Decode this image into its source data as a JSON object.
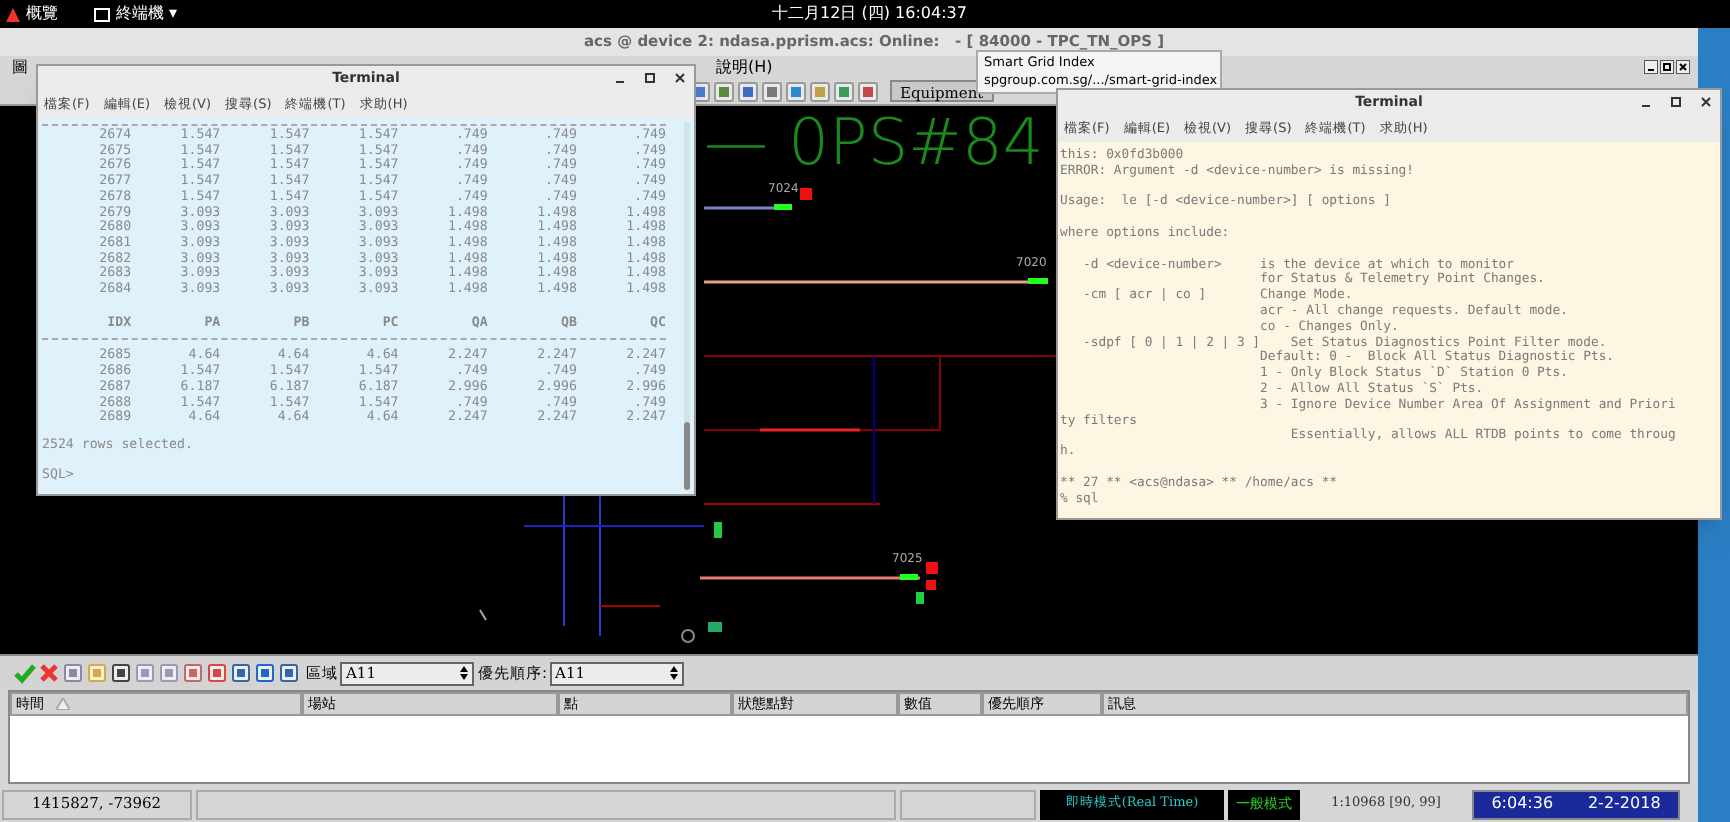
{
  "top_bar": {
    "activities": "概覽",
    "app_menu": "終端機 ▾",
    "clock": "十二月12日 (四) 16:04:37"
  },
  "app_window": {
    "title": "acs @ device 2: ndasa.pprism.acs: Online:   - [ 84000 - TPC_TN_OPS ]",
    "menus": [
      "圖",
      "說明(H)"
    ],
    "toolbar_button": "Equipment"
  },
  "tooltip": {
    "title": "Smart Grid Index",
    "url": "spgroup.com.sg/.../smart-grid-index"
  },
  "diagram": {
    "title": "— 0PS#84",
    "labels": [
      {
        "text": "7024"
      },
      {
        "text": "7020"
      },
      {
        "text": "7025"
      }
    ]
  },
  "terminal_left": {
    "title": "Terminal",
    "menus": [
      "檔案(F)",
      "編輯(E)",
      "檢視(V)",
      "搜尋(S)",
      "終端機(T)",
      "求助(H)"
    ],
    "rows": [
      [
        "2674",
        "1.547",
        "1.547",
        "1.547",
        ".749",
        ".749",
        ".749"
      ],
      [
        "2675",
        "1.547",
        "1.547",
        "1.547",
        ".749",
        ".749",
        ".749"
      ],
      [
        "2676",
        "1.547",
        "1.547",
        "1.547",
        ".749",
        ".749",
        ".749"
      ],
      [
        "2677",
        "1.547",
        "1.547",
        "1.547",
        ".749",
        ".749",
        ".749"
      ],
      [
        "2678",
        "1.547",
        "1.547",
        "1.547",
        ".749",
        ".749",
        ".749"
      ],
      [
        "2679",
        "3.093",
        "3.093",
        "3.093",
        "1.498",
        "1.498",
        "1.498"
      ],
      [
        "2680",
        "3.093",
        "3.093",
        "3.093",
        "1.498",
        "1.498",
        "1.498"
      ],
      [
        "2681",
        "3.093",
        "3.093",
        "3.093",
        "1.498",
        "1.498",
        "1.498"
      ],
      [
        "2682",
        "3.093",
        "3.093",
        "3.093",
        "1.498",
        "1.498",
        "1.498"
      ],
      [
        "2683",
        "3.093",
        "3.093",
        "3.093",
        "1.498",
        "1.498",
        "1.498"
      ],
      [
        "2684",
        "3.093",
        "3.093",
        "3.093",
        "1.498",
        "1.498",
        "1.498"
      ]
    ],
    "header": [
      "IDX",
      "PA",
      "PB",
      "PC",
      "QA",
      "QB",
      "QC"
    ],
    "rows_after": [
      [
        "2685",
        "4.64",
        "4.64",
        "4.64",
        "2.247",
        "2.247",
        "2.247"
      ],
      [
        "2686",
        "1.547",
        "1.547",
        "1.547",
        ".749",
        ".749",
        ".749"
      ],
      [
        "2687",
        "6.187",
        "6.187",
        "6.187",
        "2.996",
        "2.996",
        "2.996"
      ],
      [
        "2688",
        "1.547",
        "1.547",
        "1.547",
        ".749",
        ".749",
        ".749"
      ],
      [
        "2689",
        "4.64",
        "4.64",
        "4.64",
        "2.247",
        "2.247",
        "2.247"
      ]
    ],
    "footer": "2524 rows selected.",
    "prompt": "SQL>"
  },
  "terminal_right": {
    "title": "Terminal",
    "menus": [
      "檔案(F)",
      "編輯(E)",
      "檢視(V)",
      "搜尋(S)",
      "終端機(T)",
      "求助(H)"
    ],
    "lines": [
      {
        "text": "this: 0x0fd3b000",
        "space_before": false
      },
      {
        "text": "ERROR: Argument -d <device-number> is missing!",
        "space_before": false
      },
      {
        "text": "Usage:  le [-d <device-number>] [ options ]",
        "space_before": true
      },
      {
        "text": "where options include:",
        "space_before": true
      },
      {
        "text": "   -d <device-number>     is the device at which to monitor",
        "space_before": true
      },
      {
        "text": "                          for Status & Telemetry Point Changes.",
        "space_before": false
      },
      {
        "text": "   -cm [ acr | co ]       Change Mode.",
        "space_before": false
      },
      {
        "text": "                          acr - All change requests. Default mode.",
        "space_before": false
      },
      {
        "text": "                          co - Changes Only.",
        "space_before": false
      },
      {
        "text": "   -sdpf [ 0 | 1 | 2 | 3 ]    Set Status Diagnostics Point Filter mode.",
        "space_before": false
      },
      {
        "text": "                          Default: 0 -  Block All Status Diagnostic Pts.",
        "space_before": false
      },
      {
        "text": "                          1 - Only Block Status `D` Station 0 Pts.",
        "space_before": false
      },
      {
        "text": "                          2 - Allow All Status `S` Pts.",
        "space_before": false
      },
      {
        "text": "                          3 - Ignore Device Number Area Of Assignment and Priori",
        "space_before": false
      },
      {
        "text": "ty filters",
        "space_before": false
      },
      {
        "text": "                              Essentially, allows ALL RTDB points to come throug",
        "space_before": false
      },
      {
        "text": "h.",
        "space_before": false
      },
      {
        "text": "** 27 ** <acs@ndasa> ** /home/acs **",
        "space_before": true
      },
      {
        "text": "% sql",
        "space_before": false
      }
    ]
  },
  "alarm_panel": {
    "area_label": "區域",
    "area_value": "A11",
    "priority_label": "優先順序:",
    "priority_value": "A11",
    "columns": [
      {
        "label": "時間",
        "sorted": true
      },
      {
        "label": "場站",
        "sorted": false
      },
      {
        "label": "點",
        "sorted": false
      },
      {
        "label": "狀態點對",
        "sorted": false
      },
      {
        "label": "數值",
        "sorted": false
      },
      {
        "label": "優先順序",
        "sorted": false
      },
      {
        "label": "訊息",
        "sorted": false
      }
    ]
  },
  "status_bar": {
    "coords": "1415827, -73962",
    "realtime_mode": "即時模式(Real Time)",
    "normal_mode": "一般模式",
    "scale": "1:10968 [90, 99]",
    "time": "6:04:36",
    "date": "2-2-2018"
  }
}
